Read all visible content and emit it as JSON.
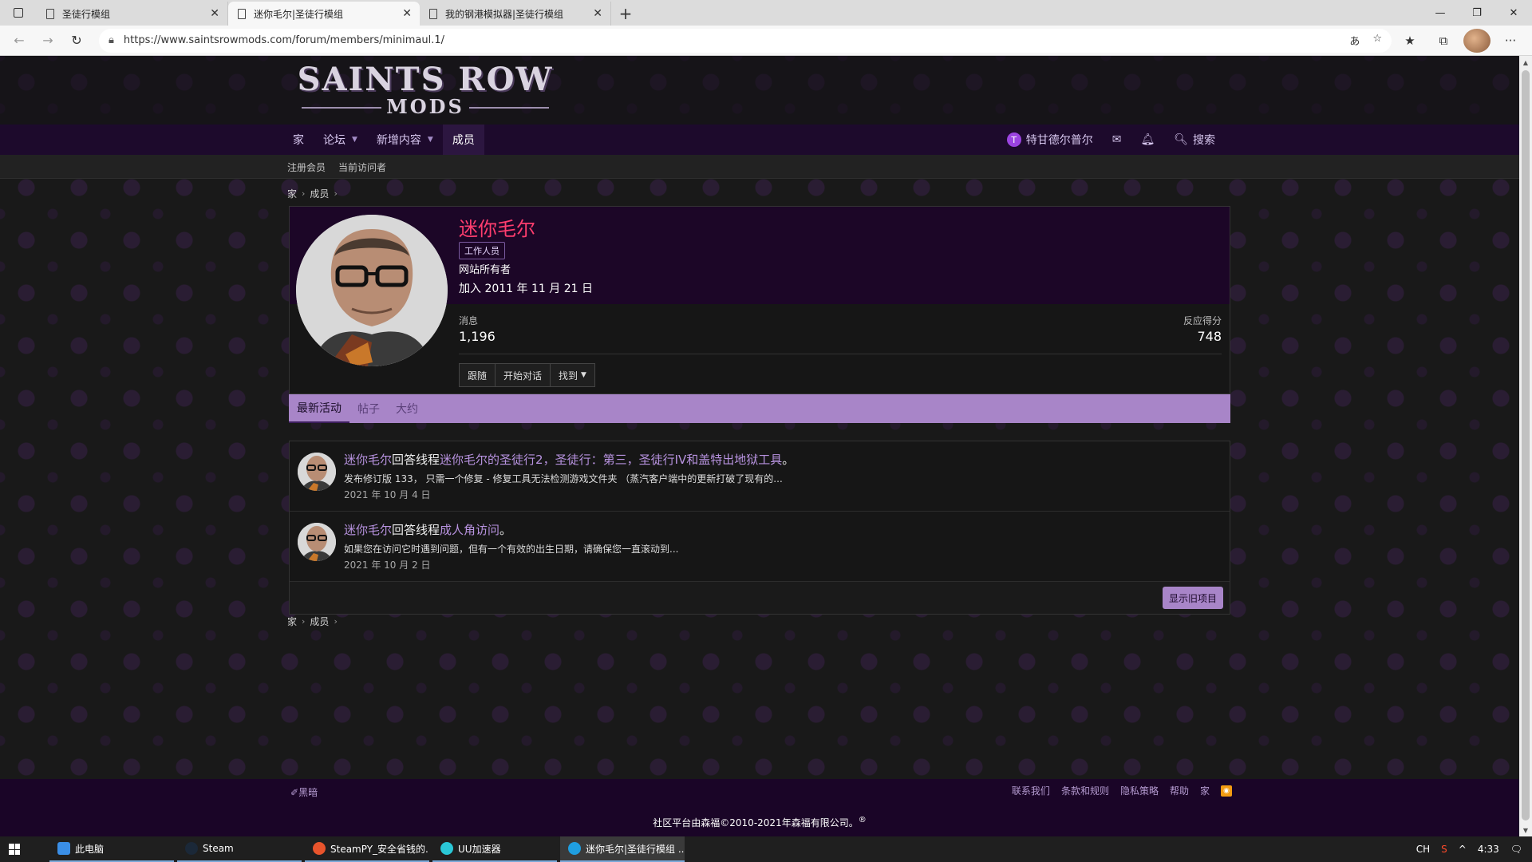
{
  "browser": {
    "tabs": [
      {
        "title": "圣徒行模组",
        "active": false
      },
      {
        "title": "迷你毛尔|圣徒行模组",
        "active": true
      },
      {
        "title": "我的钢港模拟器|圣徒行模组",
        "active": false
      }
    ],
    "url": "https://www.saintsrowmods.com/forum/members/minimaul.1/"
  },
  "logo": {
    "line1": "SAINTS ROW",
    "line2": "MODS"
  },
  "nav": {
    "home": "家",
    "forums": "论坛",
    "whats_new": "新增内容",
    "members": "成员",
    "username": "特甘德尔普尔",
    "user_initial": "T",
    "search": "搜索"
  },
  "subnav": {
    "registered": "注册会员",
    "current_visitors": "当前访问者"
  },
  "breadcrumb": {
    "home": "家",
    "members": "成员"
  },
  "profile": {
    "name": "迷你毛尔",
    "staff_badge": "工作人员",
    "role": "网站所有者",
    "joined": "加入 2011 年 11 月 21 日",
    "messages_label": "消息",
    "messages_value": "1,196",
    "reaction_label": "反应得分",
    "reaction_value": "748",
    "follow": "跟随",
    "start_conversation": "开始对话",
    "find": "找到"
  },
  "tabs": {
    "latest": "最新活动",
    "posts": "帖子",
    "about": "大约"
  },
  "activity": [
    {
      "user": "迷你毛尔",
      "action": "回答线程",
      "thread": "迷你毛尔的圣徒行2，圣徒行：第三，圣徒行IV和盖特出地狱工具",
      "end": "。",
      "snippet": "发布修订版 133，  只需一个修复 - 修复工具无法检测游戏文件夹  （蒸汽客户端中的更新打破了现有的...",
      "date": "2021 年 10 月 4 日"
    },
    {
      "user": "迷你毛尔",
      "action": "回答线程",
      "thread": "成人角访问",
      "end": "。",
      "snippet": "如果您在访问它时遇到问题，但有一个有效的出生日期，请确保您一直滚动到...",
      "date": "2021 年 10 月 2 日"
    }
  ],
  "show_older": "显示旧项目",
  "footer": {
    "style": "黑暗",
    "links": [
      "联系我们",
      "条款和规则",
      "隐私策略",
      "帮助",
      "家"
    ],
    "copyright": "社区平台由森福©2010-2021年森福有限公司。",
    "registered_mark": "®"
  },
  "taskbar": {
    "items": [
      "此电脑",
      "Steam",
      "SteamPY_安全省钱的...",
      "UU加速器",
      "迷你毛尔|圣徒行模组 ..."
    ],
    "ime": "CH",
    "time": "4:33"
  },
  "colors": {
    "accent": "#a885c8",
    "name": "#ff3d6e",
    "nav_bg": "#1d0a2c"
  }
}
